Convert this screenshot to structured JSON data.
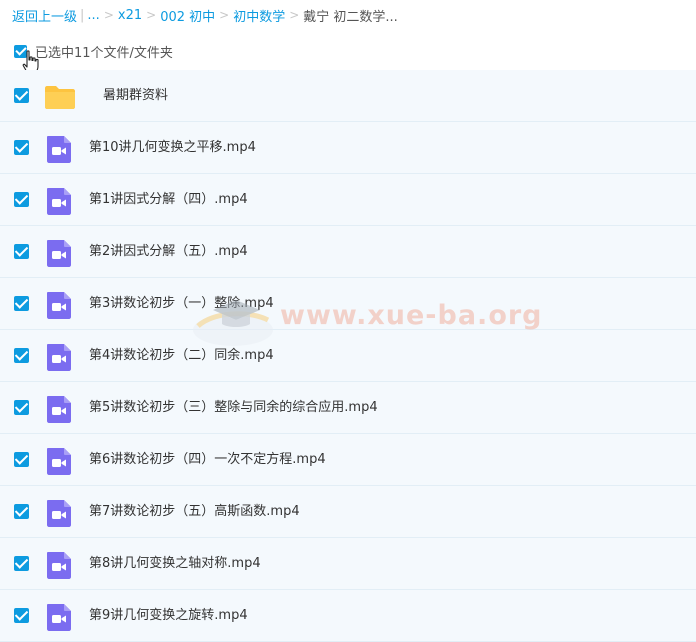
{
  "colors": {
    "accent": "#0d9be0",
    "checkbox": "#0d9be0",
    "row_bg": "#f4f9fd",
    "video_icon": "#7b6cf0",
    "folder_icon": "#fdc440",
    "watermark": "#f2b8a8"
  },
  "breadcrumb": {
    "back": "返回上一级",
    "ellipsis": "...",
    "items": [
      "x21",
      "002 初中",
      "初中数学",
      "戴宁 初二数学..."
    ]
  },
  "selection": {
    "label": "已选中11个文件/文件夹",
    "checked": true
  },
  "files": [
    {
      "name": "暑期群资料",
      "type": "folder",
      "icon": "folder-icon",
      "checked": true
    },
    {
      "name": "第10讲几何变换之平移.mp4",
      "type": "video",
      "icon": "video-file-icon",
      "checked": true
    },
    {
      "name": "第1讲因式分解（四）.mp4",
      "type": "video",
      "icon": "video-file-icon",
      "checked": true
    },
    {
      "name": "第2讲因式分解（五）.mp4",
      "type": "video",
      "icon": "video-file-icon",
      "checked": true
    },
    {
      "name": "第3讲数论初步（一）整除.mp4",
      "type": "video",
      "icon": "video-file-icon",
      "checked": true
    },
    {
      "name": "第4讲数论初步（二）同余.mp4",
      "type": "video",
      "icon": "video-file-icon",
      "checked": true
    },
    {
      "name": "第5讲数论初步（三）整除与同余的综合应用.mp4",
      "type": "video",
      "icon": "video-file-icon",
      "checked": true
    },
    {
      "name": "第6讲数论初步（四）一次不定方程.mp4",
      "type": "video",
      "icon": "video-file-icon",
      "checked": true
    },
    {
      "name": "第7讲数论初步（五）高斯函数.mp4",
      "type": "video",
      "icon": "video-file-icon",
      "checked": true
    },
    {
      "name": "第8讲几何变换之轴对称.mp4",
      "type": "video",
      "icon": "video-file-icon",
      "checked": true
    },
    {
      "name": "第9讲几何变换之旋转.mp4",
      "type": "video",
      "icon": "video-file-icon",
      "checked": true
    }
  ],
  "watermark": {
    "text": "www.xue-ba.org"
  }
}
